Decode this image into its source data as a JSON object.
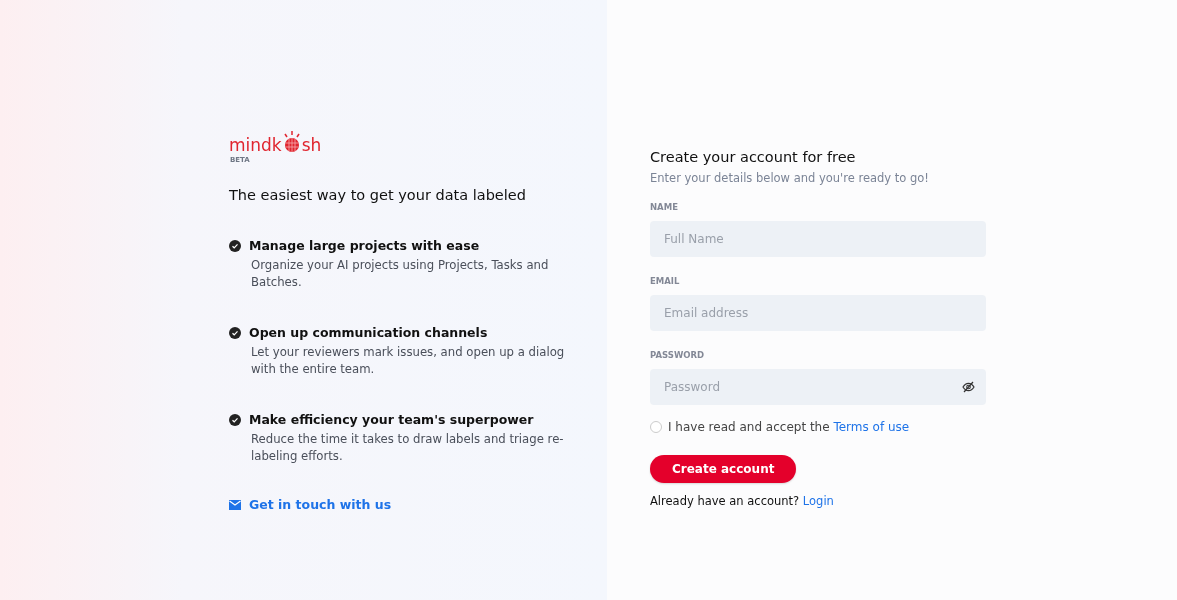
{
  "brand": {
    "logo_start": "mindk",
    "logo_end": "sh",
    "badge": "BETA"
  },
  "tagline": "The easiest way to get your data labeled",
  "features": [
    {
      "title": "Manage large projects with ease",
      "description": "Organize your AI projects using Projects, Tasks and Batches."
    },
    {
      "title": "Open up communication channels",
      "description": "Let your reviewers mark issues, and open up a dialog with the entire team."
    },
    {
      "title": "Make efficiency your team's superpower",
      "description": "Reduce the time it takes to draw labels and triage re-labeling efforts."
    }
  ],
  "contact_link": "Get in touch with us",
  "form": {
    "title": "Create your account for free",
    "subtitle": "Enter your details below and you're ready to go!",
    "fields": [
      {
        "label": "NAME",
        "placeholder": "Full Name",
        "kind": "text"
      },
      {
        "label": "EMAIL",
        "placeholder": "Email address",
        "kind": "text"
      },
      {
        "label": "PASSWORD",
        "placeholder": "Password",
        "kind": "password"
      }
    ],
    "terms": {
      "checked": false,
      "text": "I have read and accept the",
      "link": "Terms of use"
    },
    "submit": "Create account",
    "login": {
      "text": "Already have an account?",
      "link": "Login"
    }
  }
}
